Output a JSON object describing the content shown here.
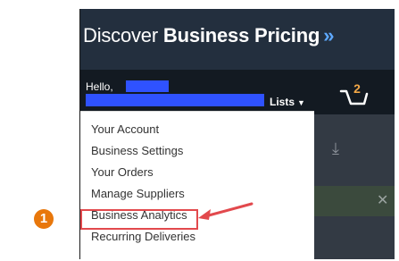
{
  "banner": {
    "text_light": "Discover ",
    "text_bold": "Business Pricing",
    "chevron": "»"
  },
  "nav": {
    "hello": "Hello,",
    "lists": "Lists",
    "cart_count": "2"
  },
  "menu": {
    "items": [
      "Your Account",
      "Business Settings",
      "Your Orders",
      "Manage Suppliers",
      "Business Analytics",
      "Recurring Deliveries"
    ],
    "highlighted": "Business Analytics"
  },
  "step": {
    "number": "1"
  },
  "colors": {
    "accent_highlight": "#e2494d",
    "step_badge": "#e8770b",
    "redaction": "#2f52ff"
  },
  "icons": [
    "cart-icon",
    "download-icon",
    "close-icon",
    "annotation-arrow-icon"
  ]
}
